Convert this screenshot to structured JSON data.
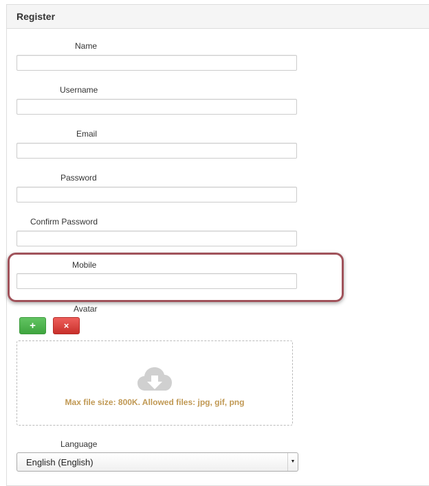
{
  "panel": {
    "title": "Register"
  },
  "form": {
    "name": {
      "label": "Name",
      "value": ""
    },
    "username": {
      "label": "Username",
      "value": ""
    },
    "email": {
      "label": "Email",
      "value": ""
    },
    "password": {
      "label": "Password",
      "value": ""
    },
    "confirm_password": {
      "label": "Confirm Password",
      "value": ""
    },
    "mobile": {
      "label": "Mobile",
      "value": ""
    },
    "avatar": {
      "label": "Avatar",
      "add_button_glyph": "+",
      "remove_button_glyph": "×",
      "add_button_color": "#5cb85c",
      "remove_button_color": "#d9534f",
      "dropzone_icon": "cloud-download-icon",
      "dropzone_message": "Max file size: 800K. Allowed files: jpg, gif, png",
      "dropzone_message_color": "#c09853"
    },
    "language": {
      "label": "Language",
      "selected": "English (English)"
    }
  },
  "highlight": {
    "target": "mobile",
    "color": "#a0525a"
  }
}
